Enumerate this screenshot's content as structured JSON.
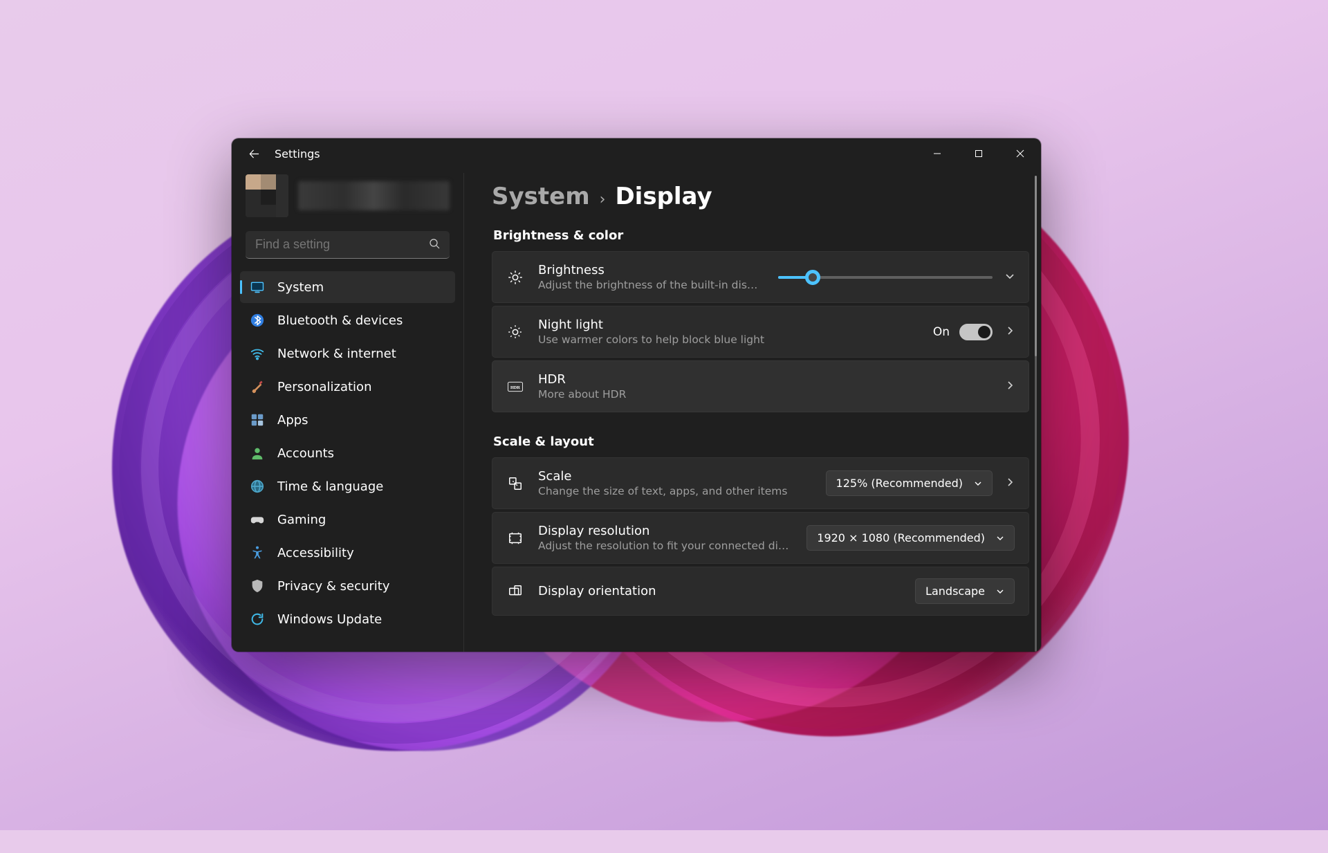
{
  "app": {
    "title": "Settings"
  },
  "search": {
    "placeholder": "Find a setting"
  },
  "sidebar": {
    "items": [
      {
        "label": "System"
      },
      {
        "label": "Bluetooth & devices"
      },
      {
        "label": "Network & internet"
      },
      {
        "label": "Personalization"
      },
      {
        "label": "Apps"
      },
      {
        "label": "Accounts"
      },
      {
        "label": "Time & language"
      },
      {
        "label": "Gaming"
      },
      {
        "label": "Accessibility"
      },
      {
        "label": "Privacy & security"
      },
      {
        "label": "Windows Update"
      }
    ]
  },
  "breadcrumb": {
    "parent": "System",
    "current": "Display"
  },
  "sections": {
    "brightness_color": {
      "title": "Brightness & color",
      "brightness": {
        "title": "Brightness",
        "sub": "Adjust the brightness of the built-in display",
        "value_pct": 16
      },
      "night_light": {
        "title": "Night light",
        "sub": "Use warmer colors to help block blue light",
        "state": "On"
      },
      "hdr": {
        "title": "HDR",
        "sub": "More about HDR"
      }
    },
    "scale_layout": {
      "title": "Scale & layout",
      "scale": {
        "title": "Scale",
        "sub": "Change the size of text, apps, and other items",
        "value": "125% (Recommended)"
      },
      "resolution": {
        "title": "Display resolution",
        "sub": "Adjust the resolution to fit your connected display",
        "value": "1920 × 1080 (Recommended)"
      },
      "orientation": {
        "title": "Display orientation",
        "value": "Landscape"
      }
    }
  },
  "colors": {
    "accent": "#4cc2ff"
  }
}
